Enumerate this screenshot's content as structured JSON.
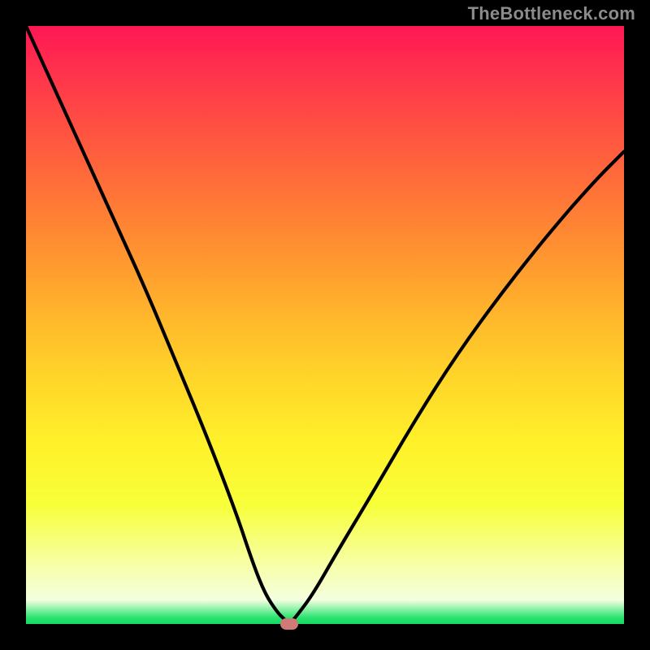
{
  "watermark": "TheBottleneck.com",
  "colors": {
    "background": "#000000",
    "gradient_top": "#ff1754",
    "gradient_bottom": "#14d964",
    "curve_stroke": "#000000",
    "marker_fill": "#cf7a76",
    "watermark_text": "#8b8b8b"
  },
  "chart_data": {
    "type": "line",
    "title": "",
    "xlabel": "",
    "ylabel": "",
    "xlim": [
      0,
      100
    ],
    "ylim": [
      0,
      100
    ],
    "grid": false,
    "legend": false,
    "x": [
      0,
      5,
      10,
      15,
      20,
      25,
      30,
      35,
      38,
      40,
      42,
      43,
      44,
      45,
      48,
      52,
      58,
      65,
      72,
      80,
      88,
      95,
      100
    ],
    "values": [
      100,
      89,
      78,
      67,
      56,
      44,
      32,
      19,
      10,
      5,
      2,
      1,
      0,
      1,
      5,
      12,
      22,
      34,
      45,
      56,
      66,
      74,
      79
    ],
    "marker": {
      "x": 44,
      "y": 0
    },
    "notes": "Single V-shaped curve on rainbow vertical gradient; axes unlabeled; small rounded marker at curve minimum near bottom."
  }
}
